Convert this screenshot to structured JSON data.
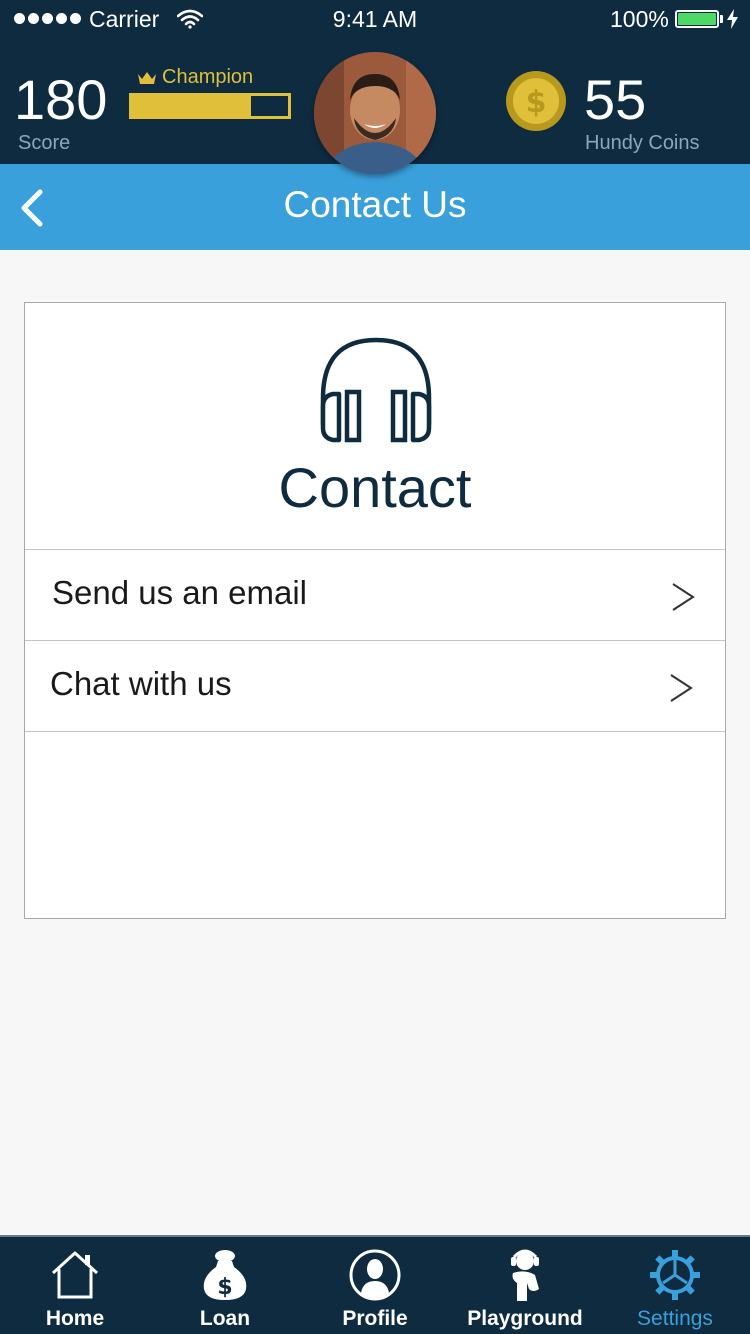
{
  "status_bar": {
    "carrier": "Carrier",
    "time": "9:41 AM",
    "battery": "100%"
  },
  "header": {
    "score": "180",
    "score_label": "Score",
    "rank": "Champion",
    "rank_progress": 0.76,
    "coins": "55",
    "coins_label": "Hundy Coins",
    "coin_symbol": "$"
  },
  "nav": {
    "title": "Contact Us"
  },
  "card": {
    "title": "Contact",
    "rows": [
      {
        "label": "Send us an email",
        "chevron": ">"
      },
      {
        "label": "Chat with us",
        "chevron": ">"
      }
    ]
  },
  "tabs": [
    {
      "label": "Home",
      "icon": "home-icon"
    },
    {
      "label": "Loan",
      "icon": "money-bag-icon"
    },
    {
      "label": "Profile",
      "icon": "profile-icon"
    },
    {
      "label": "Playground",
      "icon": "playground-icon"
    },
    {
      "label": "Settings",
      "icon": "gear-icon",
      "active": true
    }
  ],
  "colors": {
    "header_bg": "#0e2b40",
    "nav_bg": "#3aa0dc",
    "accent_gold": "#e0bf3a",
    "active_tab": "#3aa0dc"
  }
}
